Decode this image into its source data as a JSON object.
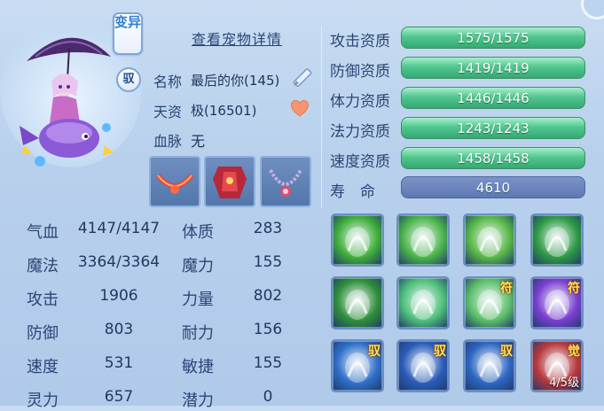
{
  "pet": {
    "variant_badge": "变异",
    "ride_badge": "驭",
    "detail_link": "查看宠物详情",
    "name_label": "名称",
    "name_value": "最后的你(145)",
    "talent_label": "天资",
    "talent_value": "极(16501)",
    "bloodline_label": "血脉",
    "bloodline_value": "无"
  },
  "equipment": [
    {
      "name": "collar-equipment",
      "color": "#c23a4a"
    },
    {
      "name": "armor-equipment",
      "color": "#b8283a"
    },
    {
      "name": "necklace-equipment",
      "color": "#9a7cb8"
    }
  ],
  "stats": [
    {
      "label": "气血",
      "value": "4147/4147",
      "label2": "体质",
      "value2": "283"
    },
    {
      "label": "魔法",
      "value": "3364/3364",
      "label2": "魔力",
      "value2": "155"
    },
    {
      "label": "攻击",
      "value": "1906",
      "label2": "力量",
      "value2": "802"
    },
    {
      "label": "防御",
      "value": "803",
      "label2": "耐力",
      "value2": "156"
    },
    {
      "label": "速度",
      "value": "531",
      "label2": "敏捷",
      "value2": "155"
    },
    {
      "label": "灵力",
      "value": "657",
      "label2": "潜力",
      "value2": "0"
    }
  ],
  "aptitudes": [
    {
      "label": "攻击资质",
      "value": "1575/1575",
      "fill": 1.0
    },
    {
      "label": "防御资质",
      "value": "1419/1419",
      "fill": 1.0
    },
    {
      "label": "体力资质",
      "value": "1446/1446",
      "fill": 1.0
    },
    {
      "label": "法力资质",
      "value": "1243/1243",
      "fill": 1.0
    },
    {
      "label": "速度资质",
      "value": "1458/1458",
      "fill": 1.0
    }
  ],
  "lifespan": {
    "label": "寿　命",
    "value": "4610"
  },
  "skills": [
    {
      "icon": "green-ghost-skill-icon",
      "tag": "",
      "level": "",
      "color": "#3fae3a"
    },
    {
      "icon": "green-spirit-wind-skill-icon",
      "tag": "",
      "level": "",
      "color": "#4bb54a"
    },
    {
      "icon": "green-boot-skill-icon",
      "tag": "",
      "level": "",
      "color": "#57b846"
    },
    {
      "icon": "green-horse-skill-icon",
      "tag": "",
      "level": "",
      "color": "#2e9a44"
    },
    {
      "icon": "green-muscle-skill-icon",
      "tag": "",
      "level": "",
      "color": "#2f8f3a"
    },
    {
      "icon": "purple-heart-skill-icon",
      "tag": "",
      "level": "",
      "color": "#4fc07a"
    },
    {
      "icon": "green-wing-heart-skill-icon",
      "tag": "符",
      "level": "",
      "color": "#5cc06a"
    },
    {
      "icon": "purple-burst-skill-icon",
      "tag": "符",
      "level": "",
      "color": "#7a3fd0"
    },
    {
      "icon": "blue-shield-skill-icon",
      "tag": "驭",
      "level": "",
      "color": "#2f6fc8"
    },
    {
      "icon": "blue-slash-skill-icon",
      "tag": "驭",
      "level": "",
      "color": "#2a5cb8"
    },
    {
      "icon": "blue-shards-skill-icon",
      "tag": "驭",
      "level": "",
      "color": "#2d66c2"
    },
    {
      "icon": "red-awaken-skill-icon",
      "tag": "觉",
      "level": "4/5级",
      "color": "#b8383c"
    }
  ],
  "colors": {
    "bar_green": "#52c690",
    "lifespan_bar": "#5e78b3",
    "text": "#2b4675"
  }
}
